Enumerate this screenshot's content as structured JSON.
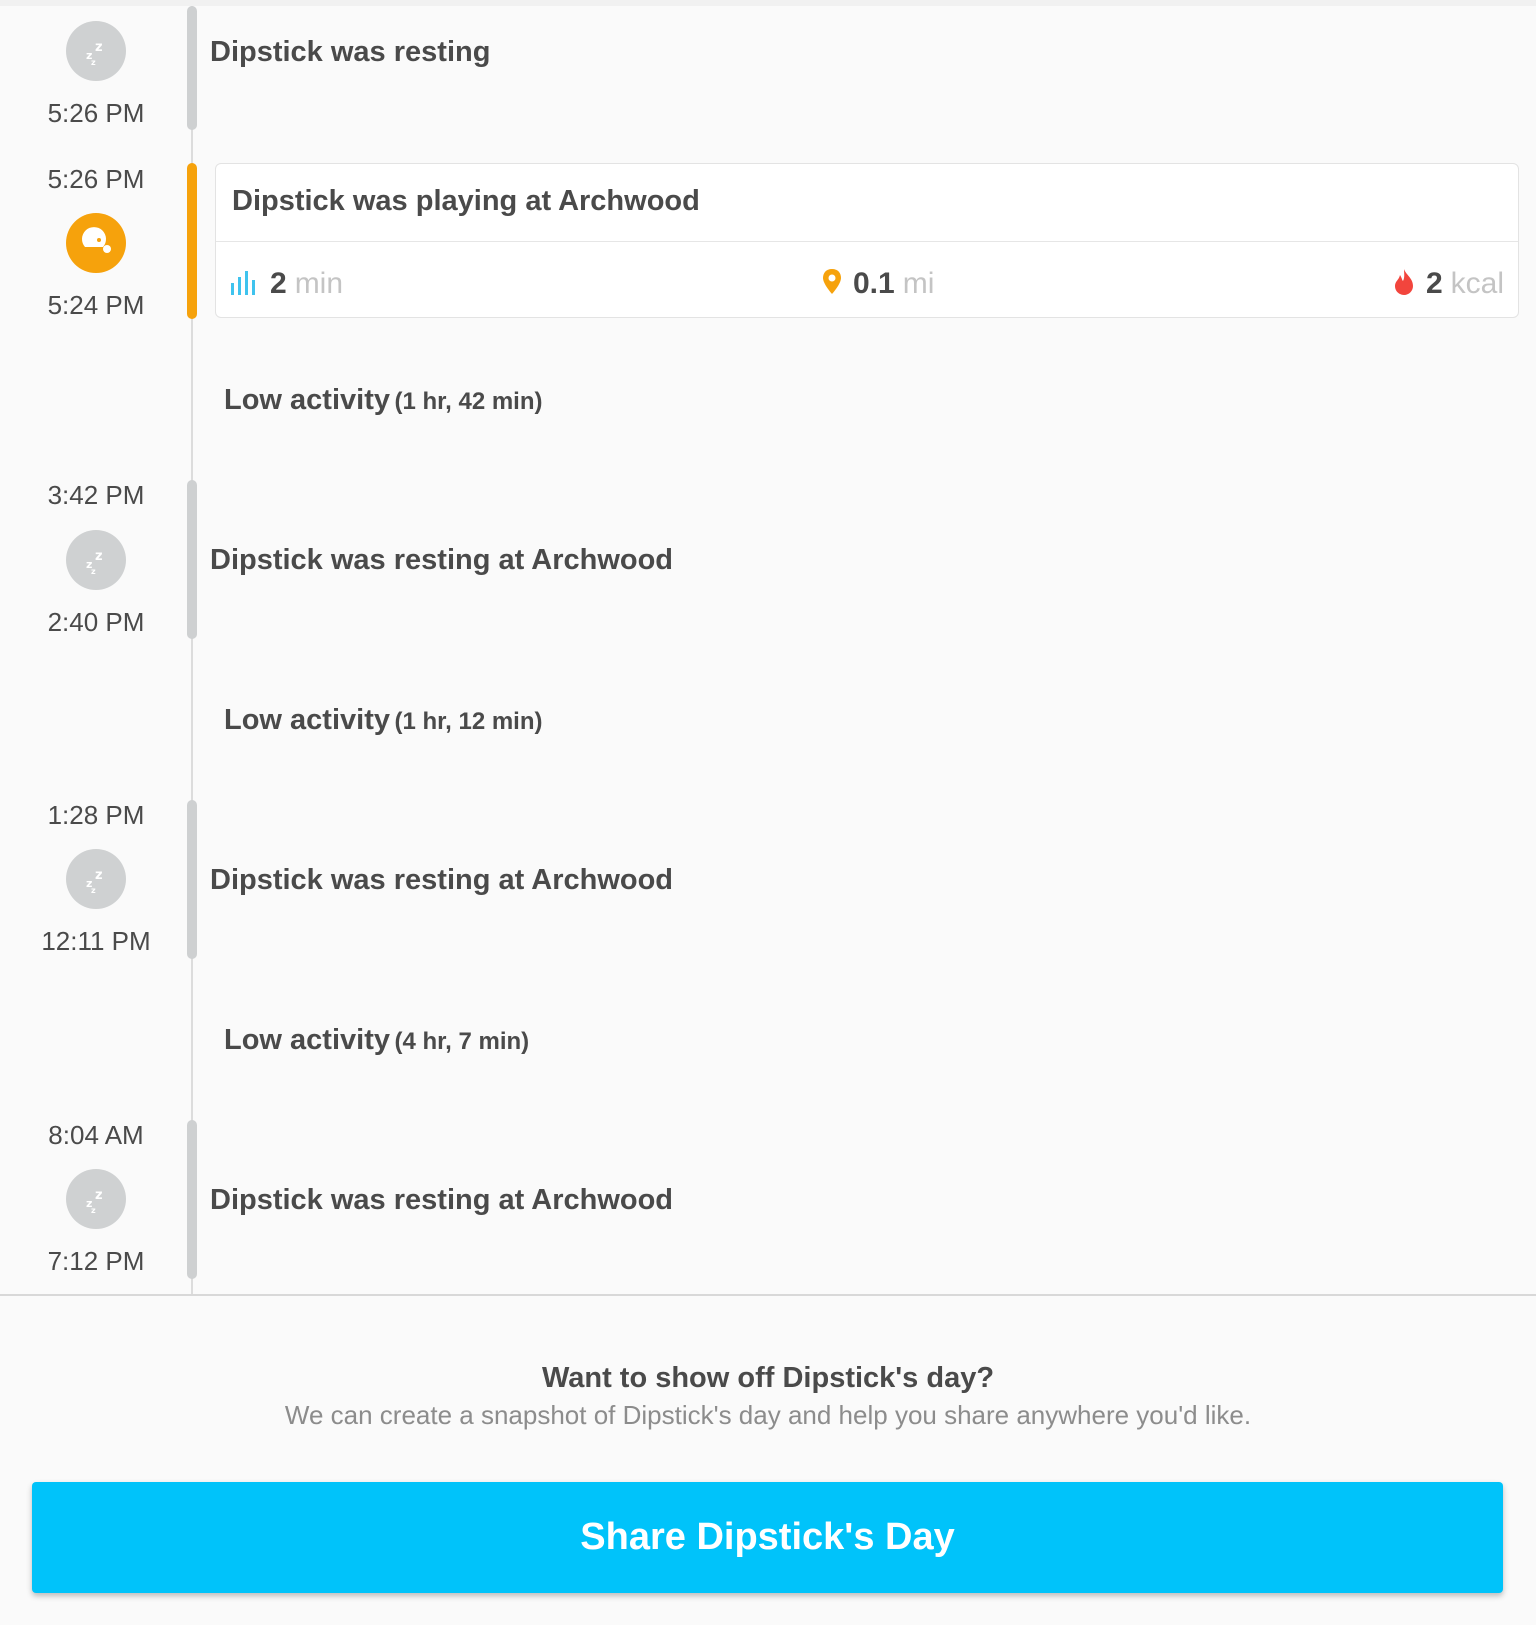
{
  "timeline": {
    "rest1": {
      "title": "Dipstick was resting",
      "end_time": "5:26 PM",
      "icon": "sleep-zzz-icon"
    },
    "play": {
      "title": "Dipstick was playing at Archwood",
      "start_time": "5:26 PM",
      "end_time": "5:24 PM",
      "icon": "ball-icon",
      "stats": {
        "duration_value": "2",
        "duration_unit": "min",
        "distance_value": "0.1",
        "distance_unit": "mi",
        "calories_value": "2",
        "calories_unit": "kcal"
      }
    },
    "low1": {
      "label": "Low activity",
      "duration": "(1 hr, 42 min)"
    },
    "rest2": {
      "title": "Dipstick was resting at Archwood",
      "start_time": "3:42 PM",
      "end_time": "2:40 PM",
      "icon": "sleep-zzz-icon"
    },
    "low2": {
      "label": "Low activity",
      "duration": "(1 hr, 12 min)"
    },
    "rest3": {
      "title": "Dipstick was resting at Archwood",
      "start_time": "1:28 PM",
      "end_time": "12:11 PM",
      "icon": "sleep-zzz-icon"
    },
    "low3": {
      "label": "Low activity",
      "duration": "(4 hr, 7 min)"
    },
    "rest4": {
      "title": "Dipstick was resting at Archwood",
      "start_time": "8:04 AM",
      "end_time": "7:12 PM",
      "icon": "sleep-zzz-icon"
    }
  },
  "share": {
    "heading": "Want to show off Dipstick's day?",
    "subtext": "We can create a snapshot of Dipstick's day and help you share anywhere you'd like.",
    "button_label": "Share Dipstick's Day"
  },
  "colors": {
    "accent_play": "#f6a20c",
    "rest_gray": "#ced0d1",
    "share_button": "#00c3fa",
    "duration_icon": "#3fc3ee",
    "calorie_icon": "#f2453d"
  }
}
